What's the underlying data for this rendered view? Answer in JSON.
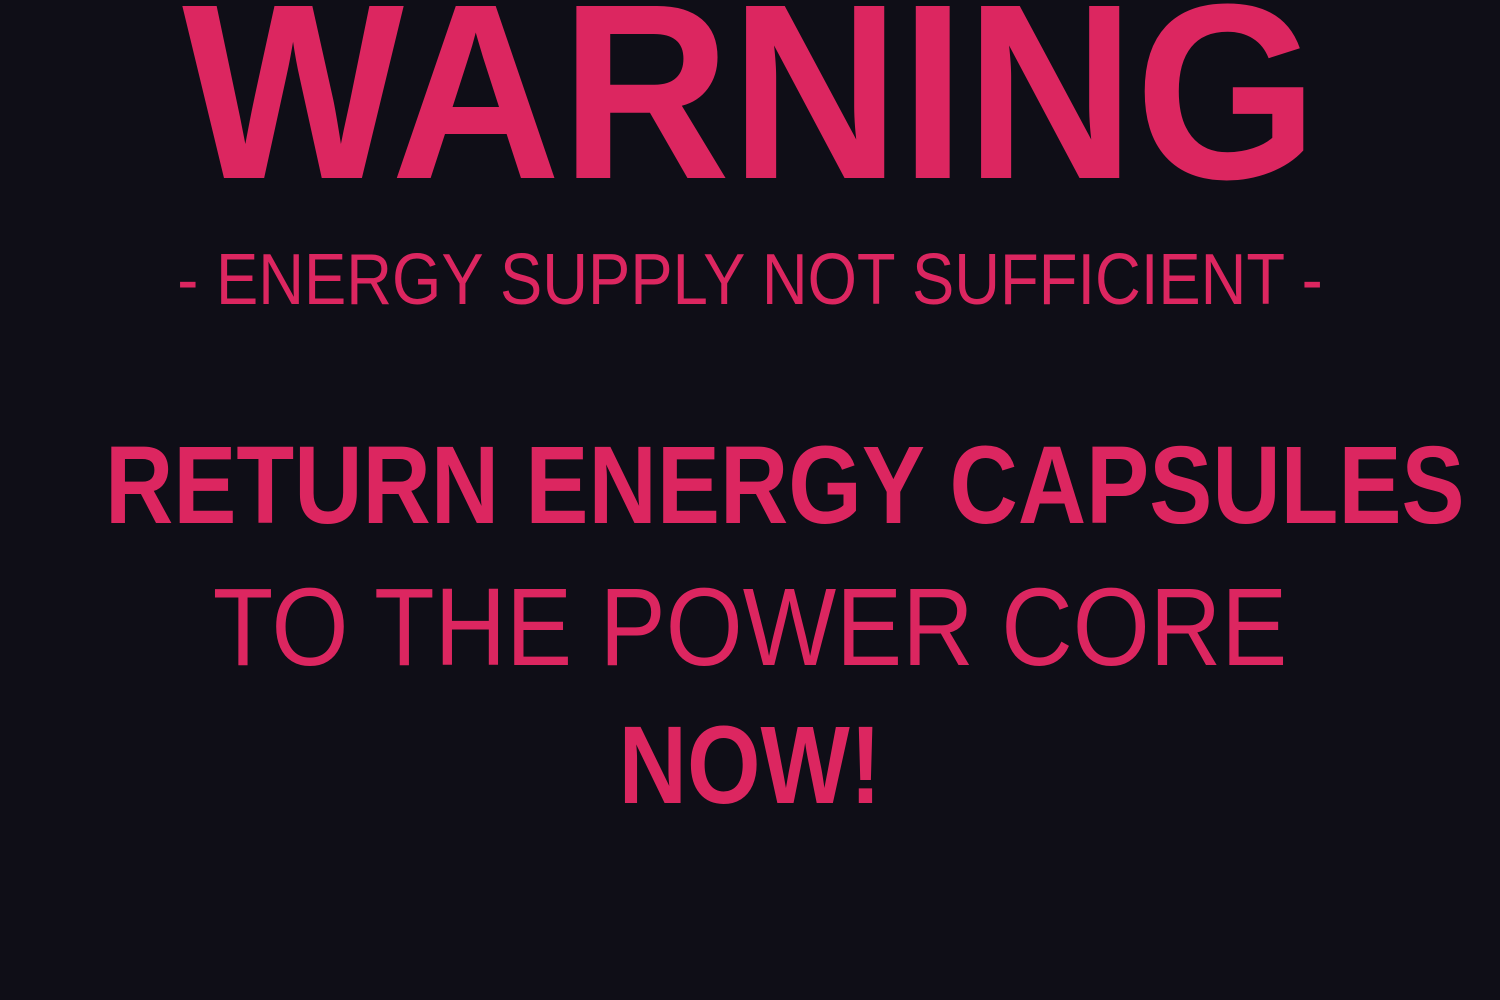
{
  "warning_screen": {
    "title": "WARNING",
    "subtitle": "- ENERGY SUPPLY NOT SUFFICIENT -",
    "instruction_line_1": "RETURN ENERGY CAPSULES",
    "instruction_line_2": "TO THE POWER CORE",
    "instruction_line_3": "NOW!"
  },
  "colors": {
    "background": "#0f0e17",
    "accent": "#dc2660"
  }
}
